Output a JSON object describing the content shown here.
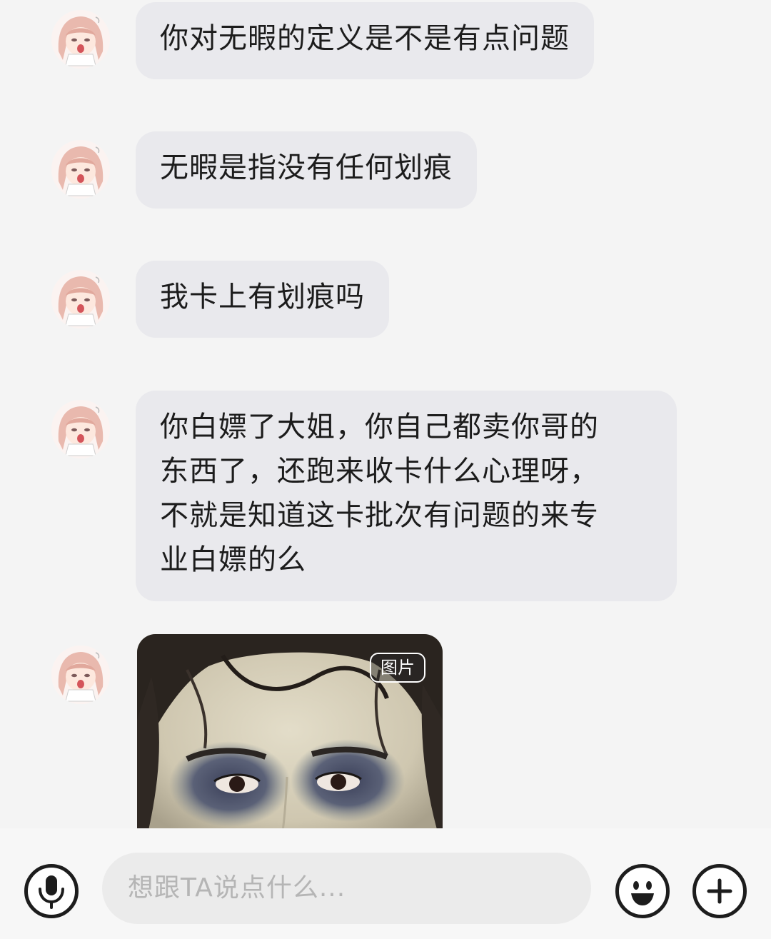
{
  "messages": [
    {
      "text": "你对无暇的定义是不是有点问题"
    },
    {
      "text": "无暇是指没有任何划痕"
    },
    {
      "text": "我卡上有划痕吗"
    },
    {
      "lines": [
        "你白嫖了大姐，你自己都卖你哥的",
        "东西了，还跑来收卡什么心理呀，",
        "不就是知道这卡批次有问题的来专",
        "业白嫖的么"
      ]
    }
  ],
  "image_message": {
    "tag_label": "图片"
  },
  "avatar_icon": "anime-girl-crying-avatar",
  "input": {
    "placeholder": "想跟TA说点什么..."
  },
  "toolbar": {
    "voice_icon": "microphone-icon",
    "emoji_icon": "smiley-icon",
    "more_icon": "plus-icon"
  },
  "colors": {
    "background": "#f4f4f4",
    "bubble": "#e9e9ed",
    "text": "#1c1c1c",
    "placeholder": "#b5b5b5"
  }
}
